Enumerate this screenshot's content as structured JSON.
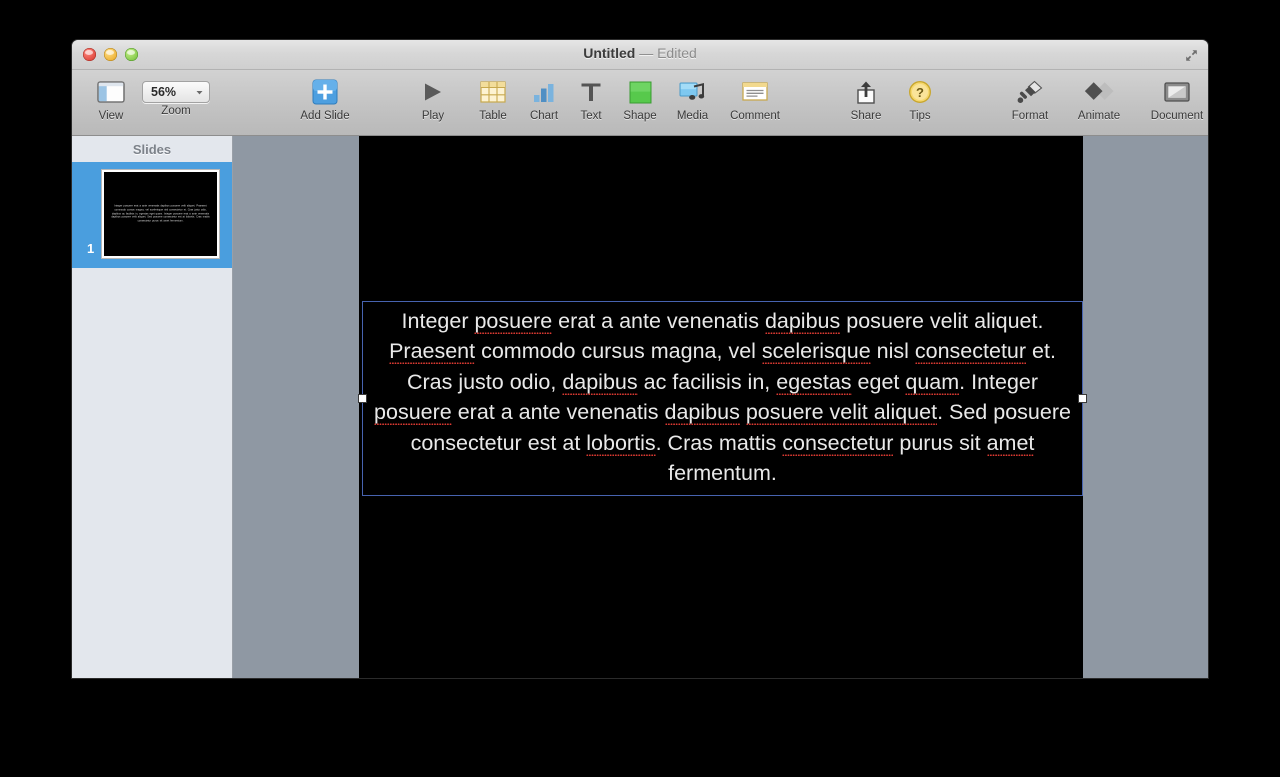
{
  "window": {
    "title_main": "Untitled",
    "title_suffix": " — Edited",
    "fullscreen_icon": "expand-arrows-icon",
    "traffic_lights": [
      {
        "name": "close-button",
        "color": "#e14b42"
      },
      {
        "name": "minimize-button",
        "color": "#eeb43a"
      },
      {
        "name": "zoom-button",
        "color": "#86cb4c"
      }
    ]
  },
  "toolbar": {
    "view": {
      "label": "View",
      "icon": "view-panel-icon"
    },
    "zoom": {
      "label": "Zoom",
      "value": "56%",
      "icon": "chevron-down-icon"
    },
    "add_slide": {
      "label": "Add Slide",
      "icon": "plus-icon"
    },
    "play": {
      "label": "Play",
      "icon": "play-triangle-icon"
    },
    "insert_items": [
      {
        "label": "Table",
        "icon": "table-icon"
      },
      {
        "label": "Chart",
        "icon": "bar-chart-icon"
      },
      {
        "label": "Text",
        "icon": "text-t-icon"
      },
      {
        "label": "Shape",
        "icon": "green-square-shape-icon"
      },
      {
        "label": "Media",
        "icon": "media-music-icon"
      },
      {
        "label": "Comment",
        "icon": "comment-note-icon"
      }
    ],
    "share": {
      "label": "Share",
      "icon": "share-upload-icon"
    },
    "tips": {
      "label": "Tips",
      "icon": "question-mark-icon"
    },
    "inspectors": [
      {
        "label": "Format",
        "icon": "paintbrush-icon"
      },
      {
        "label": "Animate",
        "icon": "animate-diamonds-icon"
      },
      {
        "label": "Document",
        "icon": "document-frame-icon"
      }
    ]
  },
  "sidebar": {
    "header": "Slides",
    "slides": [
      {
        "number": "1",
        "selected": true
      }
    ]
  },
  "slide": {
    "background": "#000000",
    "text_segments": [
      {
        "t": "Integer ",
        "mis": false
      },
      {
        "t": "posuere",
        "mis": true
      },
      {
        "t": " erat a ante venenatis ",
        "mis": false
      },
      {
        "t": "dapibus",
        "mis": true
      },
      {
        "t": " posuere velit aliquet. ",
        "mis": false
      },
      {
        "t": "Praesent",
        "mis": true
      },
      {
        "t": " commodo cursus magna, vel ",
        "mis": false
      },
      {
        "t": "scelerisque",
        "mis": true
      },
      {
        "t": " nisl ",
        "mis": false
      },
      {
        "t": "consectetur",
        "mis": true
      },
      {
        "t": " et. Cras justo odio, ",
        "mis": false
      },
      {
        "t": "dapibus",
        "mis": true
      },
      {
        "t": " ac facilisis in, ",
        "mis": false
      },
      {
        "t": "egestas",
        "mis": true
      },
      {
        "t": " eget ",
        "mis": false
      },
      {
        "t": "quam",
        "mis": true
      },
      {
        "t": ". Integer ",
        "mis": false
      },
      {
        "t": "posuere",
        "mis": true
      },
      {
        "t": " erat a ante venenatis ",
        "mis": false
      },
      {
        "t": "dapibus",
        "mis": true
      },
      {
        "t": " ",
        "mis": false
      },
      {
        "t": "posuere velit aliquet",
        "mis": true
      },
      {
        "t": ". Sed ",
        "mis": false
      },
      {
        "t": "posuere consectetur",
        "mis": true
      },
      {
        "t": " est at ",
        "mis": false
      },
      {
        "t": "lobortis",
        "mis": true
      },
      {
        "t": ". Cras mattis ",
        "mis": false
      },
      {
        "t": "consectetur",
        "mis": true
      },
      {
        "t": " purus sit ",
        "mis": false
      },
      {
        "t": "amet",
        "mis": true
      },
      {
        "t": " fermentum.",
        "mis": false
      }
    ],
    "full_text": "Integer posuere erat a ante venenatis dapibus posuere velit aliquet. Praesent commodo cursus magna, vel scelerisque nisl consectetur et. Cras justo odio, dapibus ac facilisis in, egestas eget quam. Integer posuere erat a ante venenatis dapibus posuere velit aliquet. Sed posuere consectetur est at lobortis. Cras mattis consectetur purus sit amet fermentum.",
    "selection": {
      "border_color": "#4763b0",
      "handles": [
        "left",
        "right"
      ]
    }
  },
  "colors": {
    "titlebar": "#d7d7d7",
    "toolbar": "#c3c3c3",
    "sidebar": "#e3e7ed",
    "canvas": "#8f98a3",
    "selection_blue": "#4a9ede",
    "spellcheck_red": "#e03b33"
  }
}
